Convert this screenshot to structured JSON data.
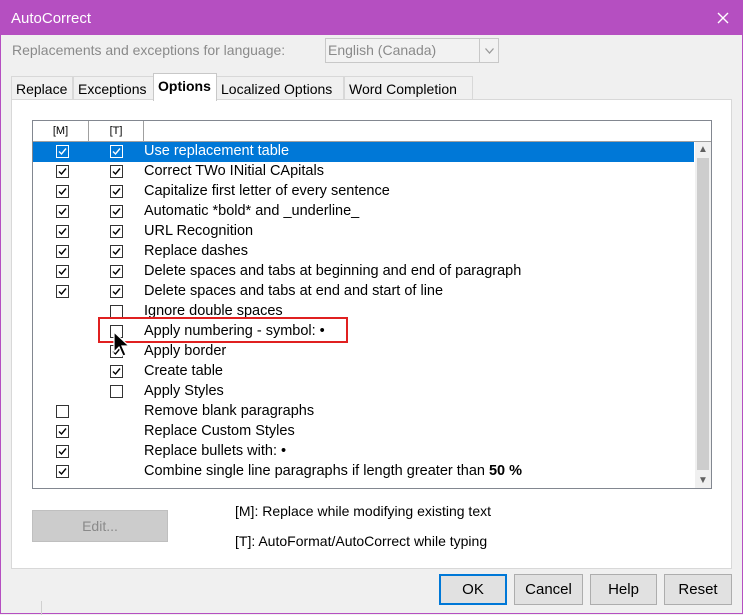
{
  "window": {
    "title": "AutoCorrect"
  },
  "language": {
    "label": "Replacements and exceptions for language:",
    "value": "English (Canada)"
  },
  "tabs": [
    {
      "label": "Replace",
      "active": false
    },
    {
      "label": "Exceptions",
      "active": false
    },
    {
      "label": "Options",
      "active": true
    },
    {
      "label": "Localized Options",
      "active": false
    },
    {
      "label": "Word Completion",
      "active": false
    }
  ],
  "options": {
    "columns": [
      "[M]",
      "[T]",
      ""
    ],
    "rows": [
      {
        "label": "Use replacement table",
        "m": true,
        "t": true,
        "selected": true
      },
      {
        "label": "Correct TWo INitial CApitals",
        "m": true,
        "t": true
      },
      {
        "label": "Capitalize first letter of every sentence",
        "m": true,
        "t": true
      },
      {
        "label": "Automatic *bold* and _underline_",
        "m": true,
        "t": true
      },
      {
        "label": "URL Recognition",
        "m": true,
        "t": true
      },
      {
        "label": "Replace dashes",
        "m": true,
        "t": true
      },
      {
        "label": "Delete spaces and tabs at beginning and end of paragraph",
        "m": true,
        "t": true
      },
      {
        "label": "Delete spaces and tabs at end and start of line",
        "m": true,
        "t": true
      },
      {
        "label": "Ignore double spaces",
        "m": null,
        "t": false
      },
      {
        "label": "Apply numbering - symbol: •",
        "m": null,
        "t": false
      },
      {
        "label": "Apply border",
        "m": null,
        "t": true
      },
      {
        "label": "Create table",
        "m": null,
        "t": true
      },
      {
        "label": "Apply Styles",
        "m": null,
        "t": false
      },
      {
        "label": "Remove blank paragraphs",
        "m": false,
        "t": null
      },
      {
        "label": "Replace Custom Styles",
        "m": true,
        "t": null
      },
      {
        "label": "Replace bullets with: •",
        "m": true,
        "t": null
      },
      {
        "label": "Combine single line paragraphs if length greater than",
        "suffix": "50 %",
        "m": true,
        "t": null
      }
    ]
  },
  "edit_button": "Edit...",
  "legend": {
    "m": "[M]: Replace while modifying existing text",
    "t": "[T]: AutoFormat/AutoCorrect while typing"
  },
  "buttons": {
    "ok": "OK",
    "cancel": "Cancel",
    "help": "Help",
    "reset": "Reset"
  },
  "colors": {
    "titlebar": "#b54fc1",
    "selection": "#0078d7",
    "highlight": "#e02020"
  }
}
